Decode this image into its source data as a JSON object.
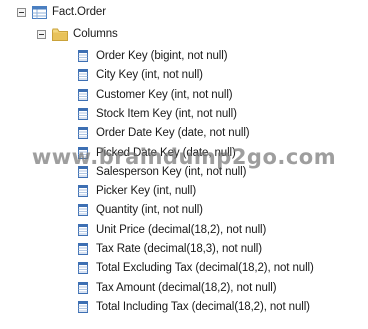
{
  "tree": {
    "table_name": "Fact.Order",
    "folder_name": "Columns",
    "columns": [
      "Order Key (bigint, not null)",
      "City Key (int, not null)",
      "Customer Key (int, not null)",
      "Stock Item Key (int, not null)",
      "Order Date Key (date, not null)",
      "Picked Date Key (date, null)",
      "Salesperson Key (int, not null)",
      "Picker Key (int, null)",
      "Quantity (int, not null)",
      "Unit Price (decimal(18,2), not null)",
      "Tax Rate (decimal(18,3), not null)",
      "Total Excluding Tax (decimal(18,2), not null)",
      "Tax Amount (decimal(18,2), not null)",
      "Total Including Tax (decimal(18,2), not null)"
    ]
  },
  "watermark": "www.braindump2go.com",
  "colors": {
    "table_icon": "#4a7fc1",
    "folder_icon": "#e8c25a",
    "column_icon": "#3d6fb3"
  }
}
